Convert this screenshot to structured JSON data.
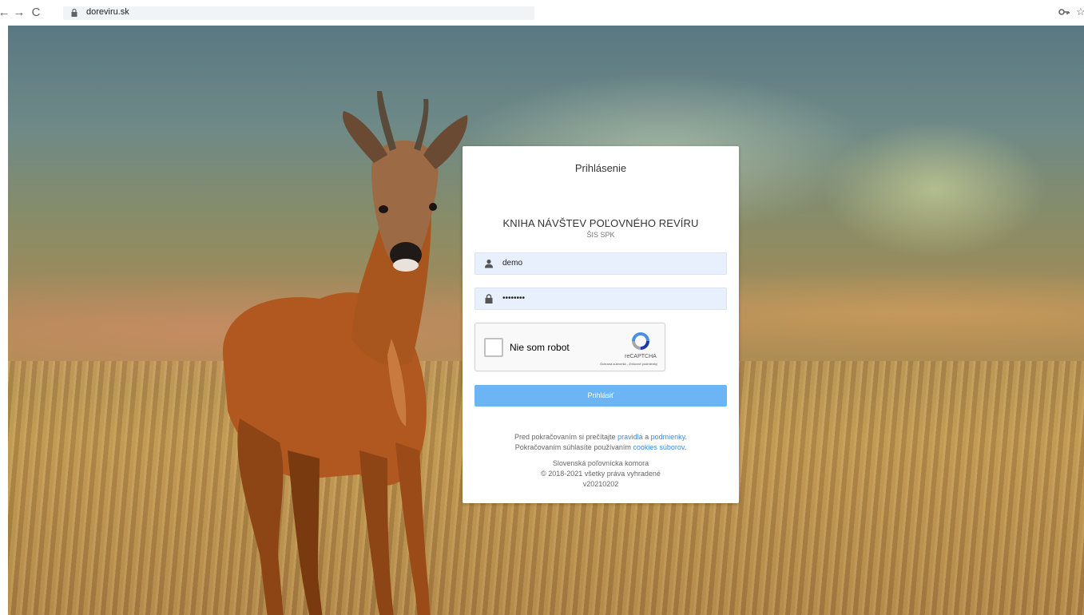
{
  "browser": {
    "url": "doreviru.sk",
    "back_glyph": "←",
    "forward_glyph": "→",
    "reload_glyph": "C",
    "star_glyph": "☆"
  },
  "login": {
    "heading": "Prihlásenie",
    "app_title": "KNIHA NÁVŠTEV POĽOVNÉHO REVÍRU",
    "app_subtitle": "ŠIS SPK",
    "username_value": "demo",
    "password_value": "••••••••",
    "submit_label": "Prihlásiť"
  },
  "recaptcha": {
    "label": "Nie som robot",
    "brand": "reCAPTCHA",
    "links": "Ochrana súkromia - Zmluvné podmienky"
  },
  "footer": {
    "line1_prefix": "Pred pokračovaním si prečítajte ",
    "rules_link": "pravidlá",
    "line1_mid": " a ",
    "terms_link": "podmienky",
    "line1_suffix": ".",
    "line2_prefix": "Pokračovaním súhlasíte používaním ",
    "cookies_link": "cookies súborov",
    "line2_suffix": ".",
    "org": "Slovenská poľovnícka komora",
    "copyright": "© 2018-2021 všetky práva vyhradené",
    "version": "v20210202"
  },
  "icons": [
    "back-arrow-icon",
    "forward-arrow-icon",
    "reload-icon",
    "lock-icon",
    "key-icon",
    "star-icon",
    "user-icon",
    "padlock-icon",
    "recaptcha-logo-icon"
  ],
  "colors": {
    "submit_bg": "#6bb5f4",
    "link": "#3a8be0",
    "field_bg": "#e8f0fe"
  }
}
